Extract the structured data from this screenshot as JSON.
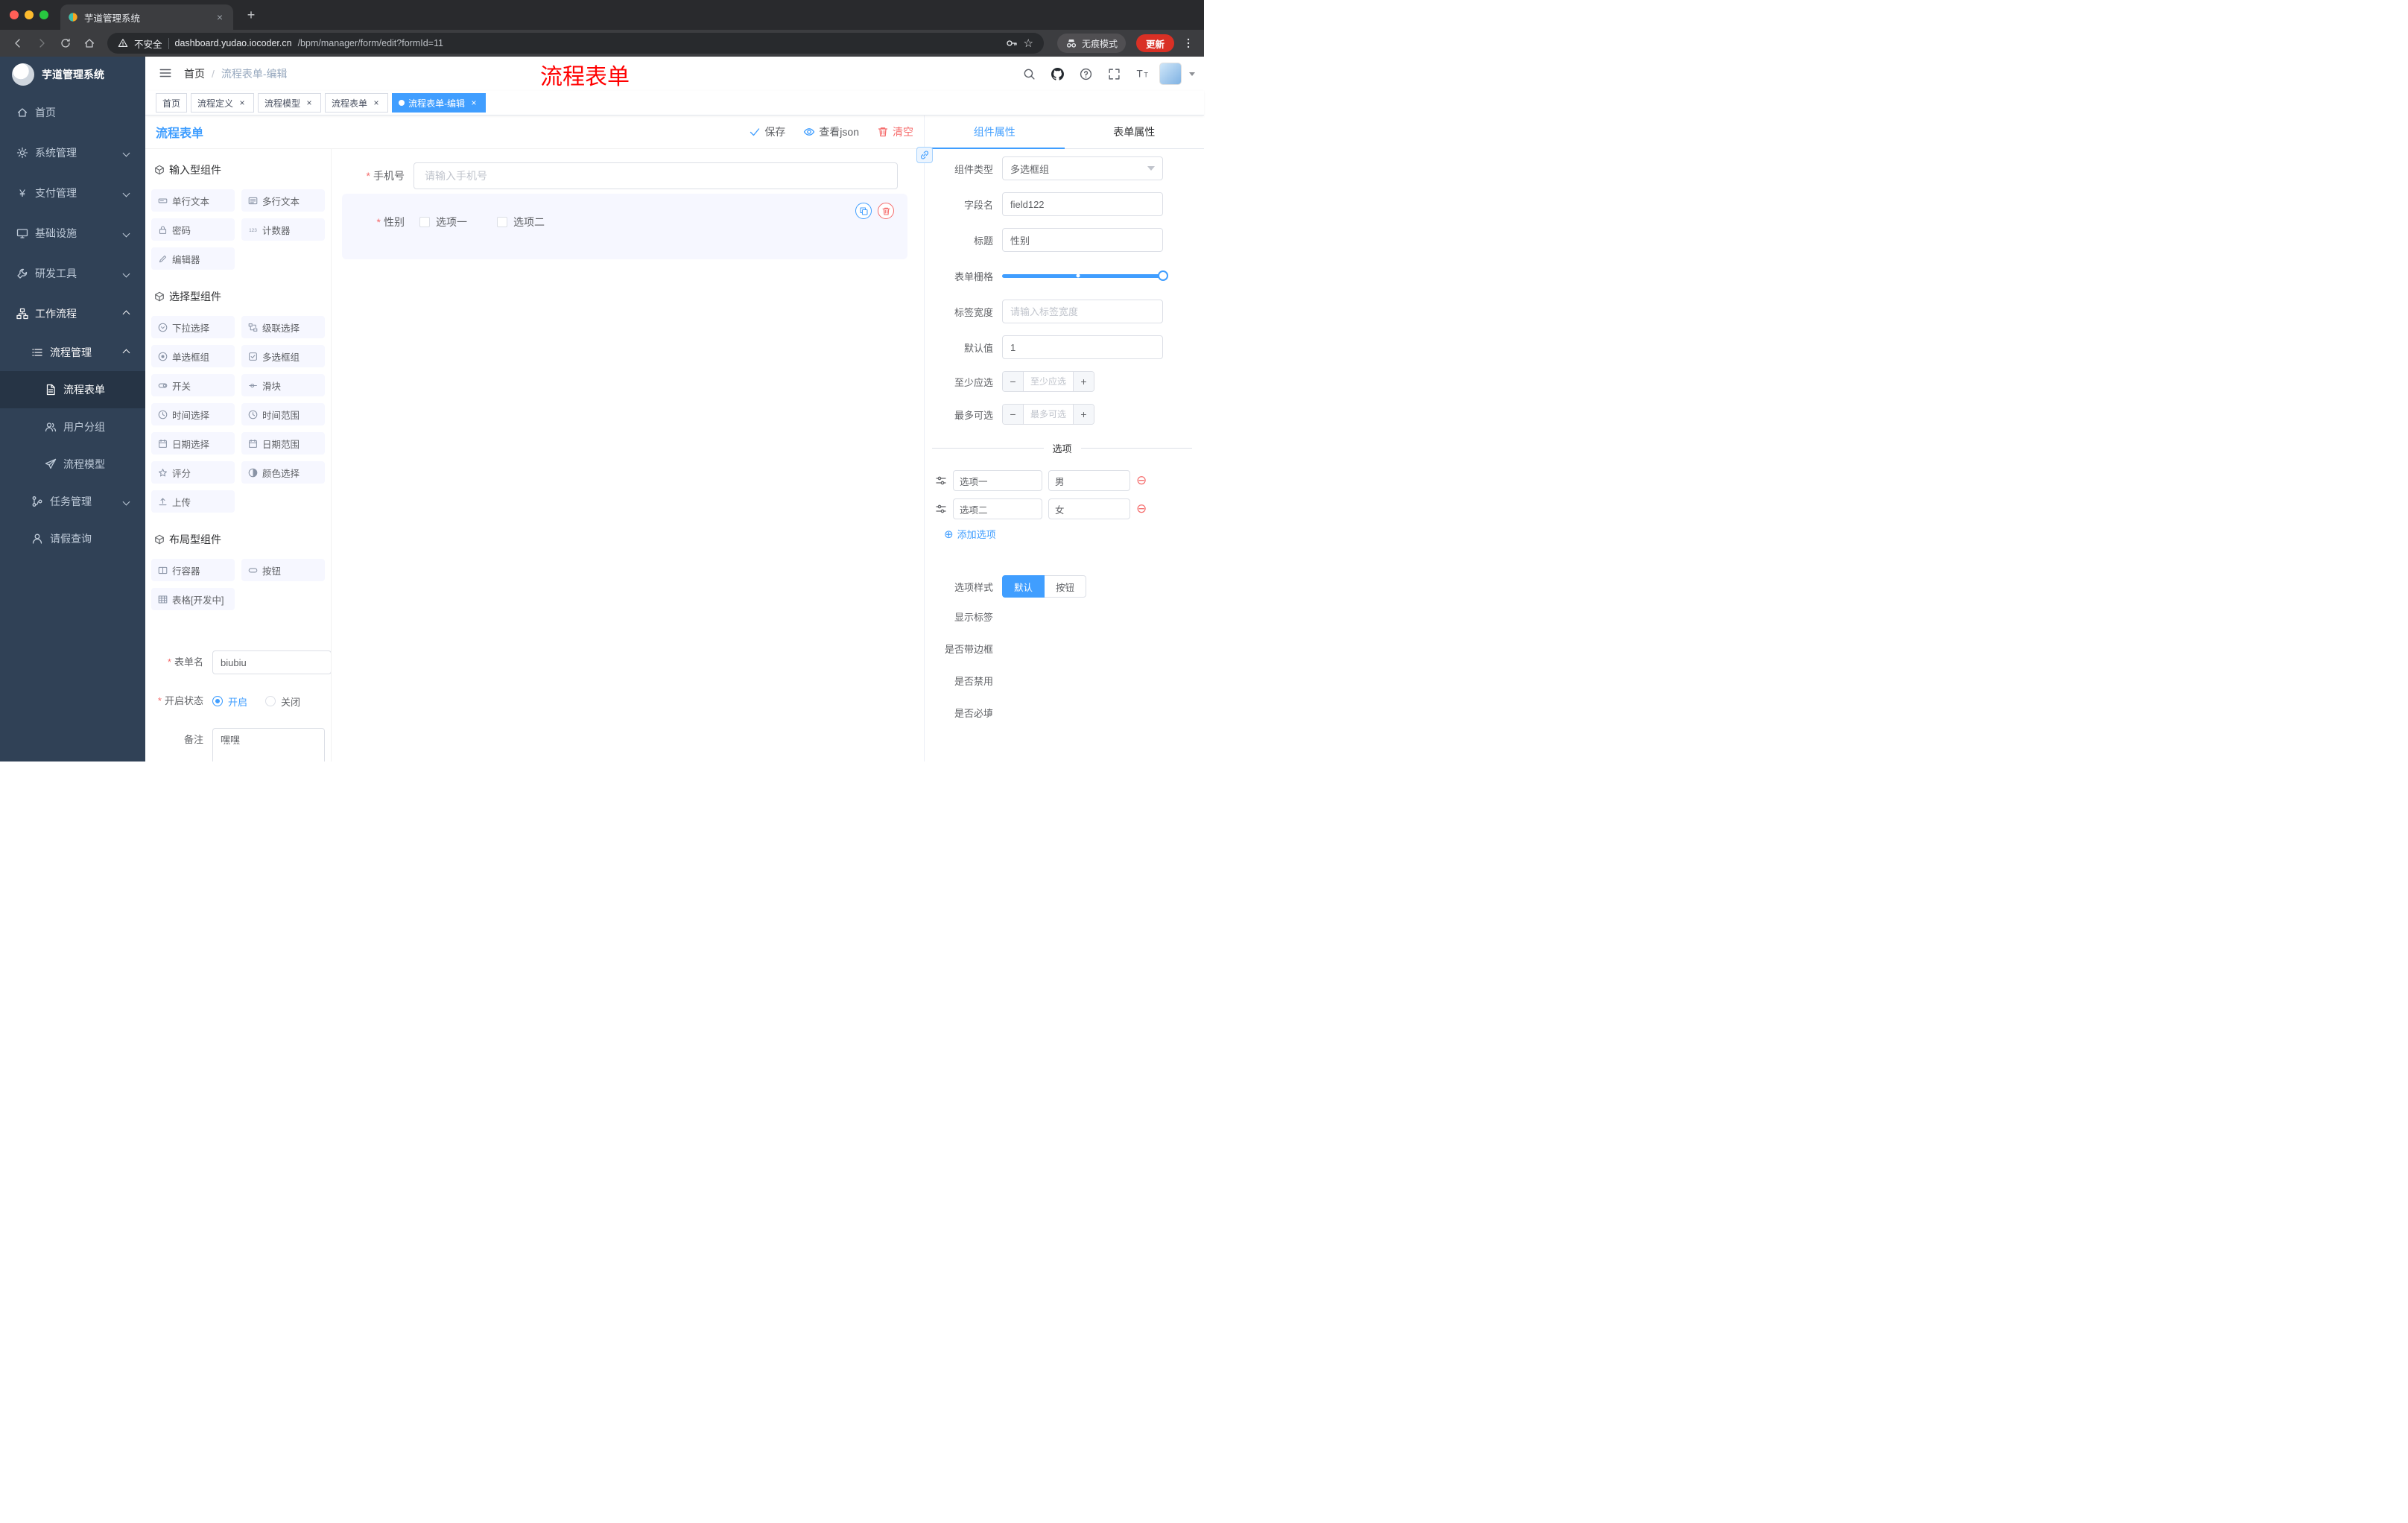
{
  "browser": {
    "tab_title": "芋道管理系统",
    "insecure_label": "不安全",
    "url_domain": "dashboard.yudao.iocoder.cn",
    "url_path": "/bpm/manager/form/edit?formId=11",
    "incognito_label": "无痕模式",
    "update_label": "更新"
  },
  "icons": {
    "close": "×",
    "plus": "+",
    "minus": "−",
    "plus_circle": "⊕",
    "minus_circle": "⊖",
    "star": "☆",
    "yen": "¥",
    "slash": "/"
  },
  "sidebar": {
    "logo_title": "芋道管理系统",
    "items": [
      {
        "label": "首页"
      },
      {
        "label": "系统管理"
      },
      {
        "label": "支付管理"
      },
      {
        "label": "基础设施"
      },
      {
        "label": "研发工具"
      },
      {
        "label": "工作流程"
      },
      {
        "label": "流程管理"
      },
      {
        "label": "流程表单"
      },
      {
        "label": "用户分组"
      },
      {
        "label": "流程模型"
      },
      {
        "label": "任务管理"
      },
      {
        "label": "请假查询"
      }
    ]
  },
  "header": {
    "breadcrumb_home": "首页",
    "breadcrumb_current": "流程表单-编辑",
    "annotation": "流程表单"
  },
  "tags": [
    {
      "label": "首页"
    },
    {
      "label": "流程定义"
    },
    {
      "label": "流程模型"
    },
    {
      "label": "流程表单"
    },
    {
      "label": "流程表单-编辑"
    }
  ],
  "designer": {
    "panel_title": "流程表单",
    "save": "保存",
    "view_json": "查看json",
    "clear": "清空"
  },
  "palette": {
    "groups": [
      {
        "title": "输入型组件",
        "items": [
          "单行文本",
          "多行文本",
          "密码",
          "计数器",
          "编辑器"
        ]
      },
      {
        "title": "选择型组件",
        "items": [
          "下拉选择",
          "级联选择",
          "单选框组",
          "多选框组",
          "开关",
          "滑块",
          "时间选择",
          "时间范围",
          "日期选择",
          "日期范围",
          "评分",
          "颜色选择",
          "上传"
        ]
      },
      {
        "title": "布局型组件",
        "items": [
          "行容器",
          "按钮",
          "表格[开发中]"
        ]
      }
    ]
  },
  "left_form": {
    "form_name_label": "表单名",
    "form_name_value": "biubiu",
    "status_label": "开启状态",
    "status_on": "开启",
    "status_off": "关闭",
    "remark_label": "备注",
    "remark_value": "嘿嘿"
  },
  "canvas": {
    "phone_label": "手机号",
    "phone_placeholder": "请输入手机号",
    "gender_label": "性别",
    "gender_options": [
      "选项一",
      "选项二"
    ]
  },
  "props": {
    "tab_component": "组件属性",
    "tab_form": "表单属性",
    "component_type_label": "组件类型",
    "component_type_value": "多选框组",
    "field_name_label": "字段名",
    "field_name_value": "field122",
    "title_label": "标题",
    "title_value": "性别",
    "grid_label": "表单栅格",
    "label_width_label": "标签宽度",
    "label_width_placeholder": "请输入标签宽度",
    "default_label": "默认值",
    "default_value": "1",
    "min_label": "至少应选",
    "min_placeholder": "至少应选",
    "max_label": "最多可选",
    "max_placeholder": "最多可选",
    "options_title": "选项",
    "options": [
      {
        "label": "选项一",
        "value": "男"
      },
      {
        "label": "选项二",
        "value": "女"
      }
    ],
    "add_option": "添加选项",
    "option_style_label": "选项样式",
    "style_default": "默认",
    "style_button": "按钮",
    "show_label": "显示标签",
    "border_label": "是否带边框",
    "disabled_label": "是否禁用",
    "required_label": "是否必填"
  },
  "colors": {
    "accent": "#409eff",
    "danger": "#f56c6c",
    "sidebar": "#304156",
    "annotation": "#ff0000"
  }
}
